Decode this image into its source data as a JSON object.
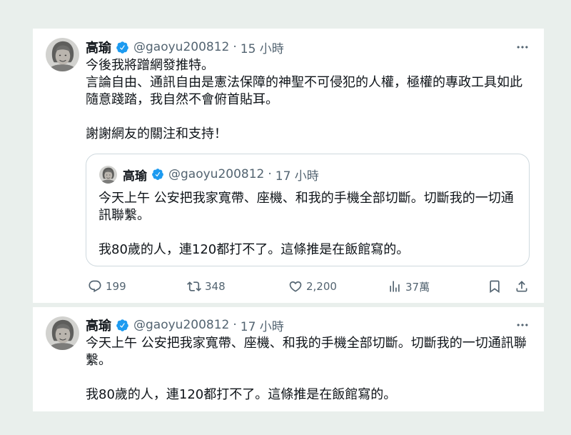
{
  "colors": {
    "page_background": "#e9efec",
    "card_background": "#ffffff",
    "primary_text": "#0f1419",
    "secondary_text": "#536471",
    "verified_badge": "#1d9bf0",
    "quote_border": "#cfd9de"
  },
  "tweets": [
    {
      "author": {
        "name": "高瑜",
        "handle": "@gaoyu200812",
        "verified": true
      },
      "separator": "·",
      "time": "15 小時",
      "more_icon": "more-icon",
      "lines": [
        "今後我將蹭網發推特。",
        "言論自由、通訊自由是憲法保障的神聖不可侵犯的人權，極權的專政工具如此",
        "隨意踐踏，我自然不會俯首貼耳。",
        "",
        "謝謝網友的關注和支持！"
      ],
      "quote": {
        "author": {
          "name": "高瑜",
          "handle": "@gaoyu200812",
          "verified": true
        },
        "separator": "·",
        "time": "17 小時",
        "lines": [
          "今天上午 公安把我家寬帶、座機、和我的手機全部切斷。切斷我的一切通",
          "訊聯繫。",
          "",
          "我80歲的人，連120都打不了。這條推是在飯館寫的。"
        ]
      },
      "actions": {
        "reply": {
          "icon": "reply-icon",
          "count": "199"
        },
        "repost": {
          "icon": "repost-icon",
          "count": "348"
        },
        "like": {
          "icon": "heart-icon",
          "count": "2,200"
        },
        "views": {
          "icon": "views-icon",
          "count": "37萬"
        },
        "bookmark": {
          "icon": "bookmark-icon"
        },
        "share": {
          "icon": "share-icon"
        }
      }
    },
    {
      "author": {
        "name": "高瑜",
        "handle": "@gaoyu200812",
        "verified": true
      },
      "separator": "·",
      "time": "17 小時",
      "more_icon": "more-icon",
      "lines": [
        "今天上午 公安把我家寬帶、座機、和我的手機全部切斷。切斷我的一切通訊聯",
        "繫。",
        "",
        "我80歲的人，連120都打不了。這條推是在飯館寫的。"
      ]
    }
  ]
}
